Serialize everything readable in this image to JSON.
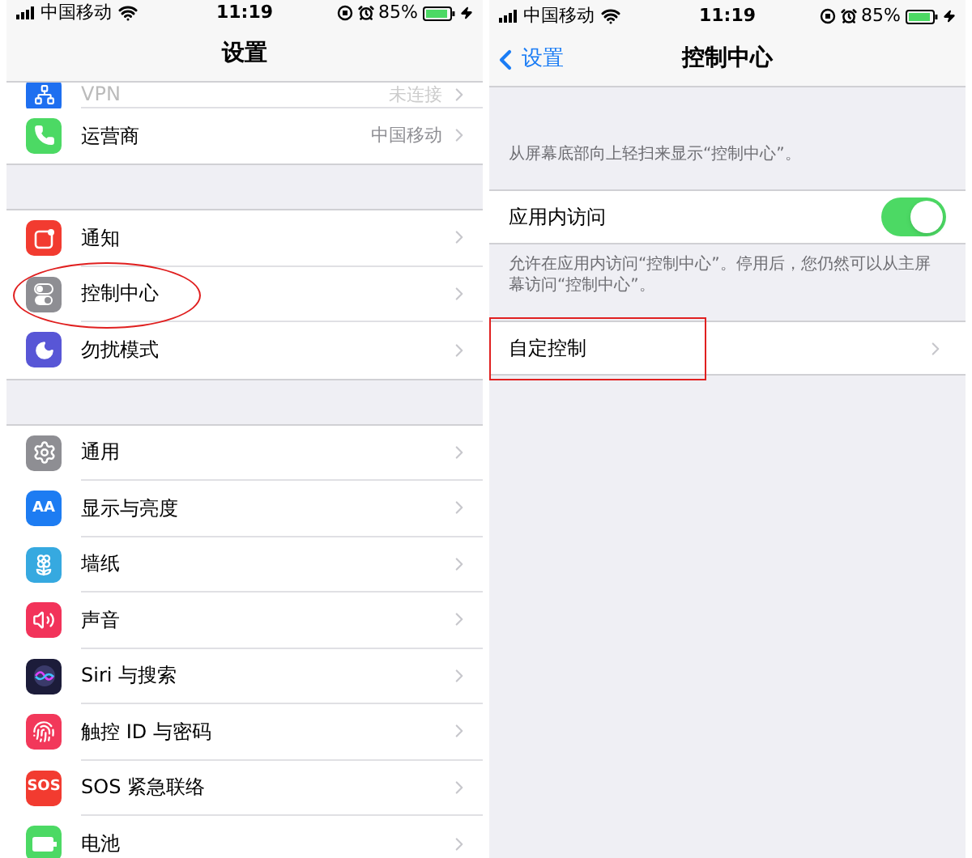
{
  "left": {
    "status_bar": {
      "carrier": "中国移动",
      "time": "11:19",
      "battery": "85%"
    },
    "title": "设置",
    "groups": [
      {
        "partial": true,
        "items": [
          {
            "label": "VPN",
            "value": "未连接",
            "color": "#1e6ff0",
            "highlighted": false
          },
          {
            "label": "运营商",
            "value": "中国移动",
            "color": "#4cd964",
            "highlighted": false
          }
        ]
      },
      {
        "partial": false,
        "items": [
          {
            "label": "通知",
            "color": "#f23b30",
            "highlighted": false
          },
          {
            "label": "控制中心",
            "color": "#8e8e93",
            "highlighted": true
          },
          {
            "label": "勿扰模式",
            "color": "#5856d6",
            "highlighted": false
          }
        ]
      },
      {
        "partial": false,
        "items": [
          {
            "label": "通用",
            "color": "#8e8e93",
            "highlighted": false
          },
          {
            "label": "显示与亮度",
            "color": "#1d7cf2",
            "icon_text": "AA",
            "highlighted": false
          },
          {
            "label": "墙纸",
            "color": "#36a9e0",
            "highlighted": false
          },
          {
            "label": "声音",
            "color": "#f2335a",
            "highlighted": false
          },
          {
            "label": "Siri 与搜索",
            "color": "#1c1c3a",
            "highlighted": false
          },
          {
            "label": "触控 ID 与密码",
            "color": "#f2385a",
            "highlighted": false
          },
          {
            "label": "SOS 紧急联络",
            "color": "#f23b30",
            "icon_text": "SOS",
            "highlighted": false
          },
          {
            "label": "电池",
            "color": "#4cd964",
            "highlighted": false
          }
        ]
      }
    ]
  },
  "right": {
    "status_bar": {
      "carrier": "中国移动",
      "time": "11:19",
      "battery": "85%"
    },
    "back": "设置",
    "title": "控制中心",
    "intro": "从屏幕底部向上轻扫来显示“控制中心”。",
    "toggle": {
      "label": "应用内访问",
      "on": true
    },
    "note": "允许在应用内访问“控制中心”。停用后，您仍然可以从主屏幕访问“控制中心”。",
    "link": {
      "label": "自定控制",
      "highlighted": true
    }
  }
}
